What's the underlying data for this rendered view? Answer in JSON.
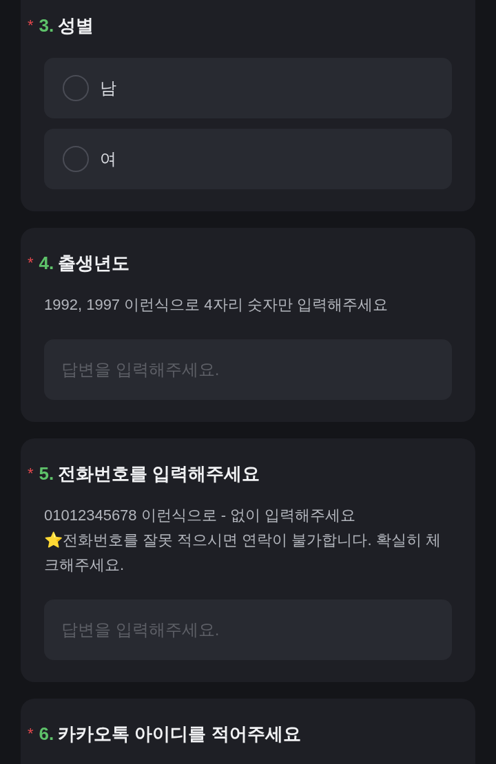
{
  "questions": [
    {
      "marker": "*",
      "number": "3.",
      "title": "성별",
      "kind": "radio",
      "options": [
        {
          "label": "남",
          "selected": false
        },
        {
          "label": "여",
          "selected": false
        }
      ]
    },
    {
      "marker": "*",
      "number": "4.",
      "title": "출생년도",
      "kind": "text",
      "description": [
        "1992, 1997 이런식으로 4자리 숫자만 입력해주세요"
      ],
      "placeholder": "답변을 입력해주세요."
    },
    {
      "marker": "*",
      "number": "5.",
      "title": "전화번호를 입력해주세요",
      "kind": "text",
      "description": [
        "01012345678 이런식으로 - 없이 입력해주세요",
        "⭐전화번호를 잘못 적으시면 연락이 불가합니다. 확실히 체크해주세요."
      ],
      "placeholder": "답변을 입력해주세요."
    },
    {
      "marker": "*",
      "number": "6.",
      "title": "카카오톡 아이디를 적어주세요",
      "kind": "none"
    }
  ]
}
